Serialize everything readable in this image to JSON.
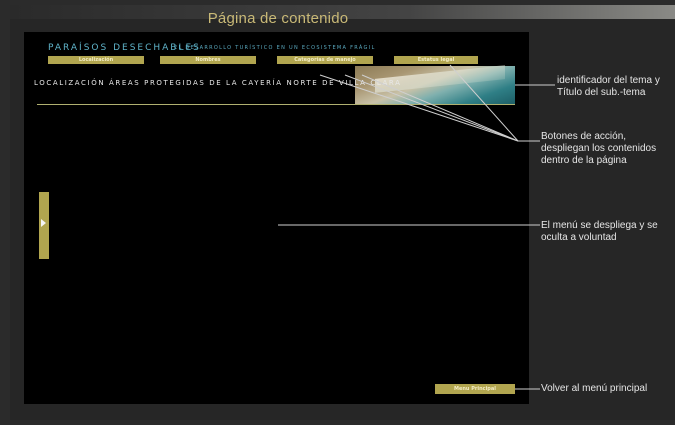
{
  "slide": {
    "title": "Página de  contenido"
  },
  "header": {
    "brand": "PARAÍSOS DESECHABLES",
    "brand_tagline": "EL DESARROLLO TURÍSTICO EN UN ECOSISTEMA FRÁGIL",
    "tabs": [
      {
        "label": "Localización"
      },
      {
        "label": "Nombres"
      },
      {
        "label": "Categorías de manejo"
      },
      {
        "label": "Estatus legal"
      }
    ],
    "subtitle": "LOCALIZACIÓN ÁREAS PROTEGIDAS DE LA CAYERÍA NORTE DE VILLA CLARA"
  },
  "footer": {
    "main_menu_label": "Menu Principal"
  },
  "annotations": {
    "topic_id_line1": "identificador del tema y",
    "topic_id_line2": "Título del sub.-tema",
    "action_buttons_line1": "Botones de acción,",
    "action_buttons_line2": "despliegan los contenidos",
    "action_buttons_line3": "dentro de la página",
    "menu_line1": "El menú se despliega y se",
    "menu_line2": "oculta a voluntad",
    "return_menu": "Volver al menú principal"
  },
  "colors": {
    "accent_gold": "#b1a54f",
    "title_gold": "#c9b977",
    "brand_blue": "#5fb3c9"
  }
}
